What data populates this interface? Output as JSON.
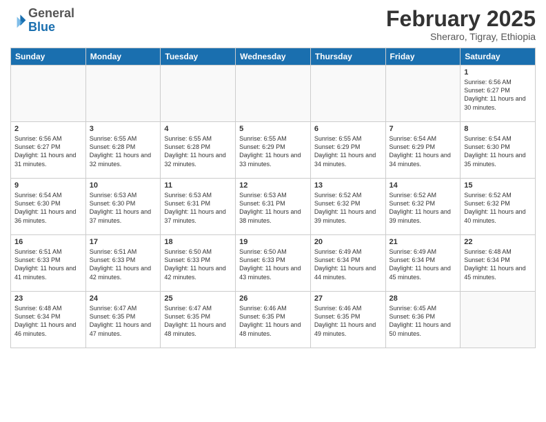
{
  "header": {
    "logo_general": "General",
    "logo_blue": "Blue",
    "month_year": "February 2025",
    "location": "Sheraro, Tigray, Ethiopia"
  },
  "days_of_week": [
    "Sunday",
    "Monday",
    "Tuesday",
    "Wednesday",
    "Thursday",
    "Friday",
    "Saturday"
  ],
  "weeks": [
    [
      {
        "day": "",
        "content": ""
      },
      {
        "day": "",
        "content": ""
      },
      {
        "day": "",
        "content": ""
      },
      {
        "day": "",
        "content": ""
      },
      {
        "day": "",
        "content": ""
      },
      {
        "day": "",
        "content": ""
      },
      {
        "day": "1",
        "content": "Sunrise: 6:56 AM\nSunset: 6:27 PM\nDaylight: 11 hours\nand 30 minutes."
      }
    ],
    [
      {
        "day": "2",
        "content": "Sunrise: 6:56 AM\nSunset: 6:27 PM\nDaylight: 11 hours\nand 31 minutes."
      },
      {
        "day": "3",
        "content": "Sunrise: 6:55 AM\nSunset: 6:28 PM\nDaylight: 11 hours\nand 32 minutes."
      },
      {
        "day": "4",
        "content": "Sunrise: 6:55 AM\nSunset: 6:28 PM\nDaylight: 11 hours\nand 32 minutes."
      },
      {
        "day": "5",
        "content": "Sunrise: 6:55 AM\nSunset: 6:29 PM\nDaylight: 11 hours\nand 33 minutes."
      },
      {
        "day": "6",
        "content": "Sunrise: 6:55 AM\nSunset: 6:29 PM\nDaylight: 11 hours\nand 34 minutes."
      },
      {
        "day": "7",
        "content": "Sunrise: 6:54 AM\nSunset: 6:29 PM\nDaylight: 11 hours\nand 34 minutes."
      },
      {
        "day": "8",
        "content": "Sunrise: 6:54 AM\nSunset: 6:30 PM\nDaylight: 11 hours\nand 35 minutes."
      }
    ],
    [
      {
        "day": "9",
        "content": "Sunrise: 6:54 AM\nSunset: 6:30 PM\nDaylight: 11 hours\nand 36 minutes."
      },
      {
        "day": "10",
        "content": "Sunrise: 6:53 AM\nSunset: 6:30 PM\nDaylight: 11 hours\nand 37 minutes."
      },
      {
        "day": "11",
        "content": "Sunrise: 6:53 AM\nSunset: 6:31 PM\nDaylight: 11 hours\nand 37 minutes."
      },
      {
        "day": "12",
        "content": "Sunrise: 6:53 AM\nSunset: 6:31 PM\nDaylight: 11 hours\nand 38 minutes."
      },
      {
        "day": "13",
        "content": "Sunrise: 6:52 AM\nSunset: 6:32 PM\nDaylight: 11 hours\nand 39 minutes."
      },
      {
        "day": "14",
        "content": "Sunrise: 6:52 AM\nSunset: 6:32 PM\nDaylight: 11 hours\nand 39 minutes."
      },
      {
        "day": "15",
        "content": "Sunrise: 6:52 AM\nSunset: 6:32 PM\nDaylight: 11 hours\nand 40 minutes."
      }
    ],
    [
      {
        "day": "16",
        "content": "Sunrise: 6:51 AM\nSunset: 6:33 PM\nDaylight: 11 hours\nand 41 minutes."
      },
      {
        "day": "17",
        "content": "Sunrise: 6:51 AM\nSunset: 6:33 PM\nDaylight: 11 hours\nand 42 minutes."
      },
      {
        "day": "18",
        "content": "Sunrise: 6:50 AM\nSunset: 6:33 PM\nDaylight: 11 hours\nand 42 minutes."
      },
      {
        "day": "19",
        "content": "Sunrise: 6:50 AM\nSunset: 6:33 PM\nDaylight: 11 hours\nand 43 minutes."
      },
      {
        "day": "20",
        "content": "Sunrise: 6:49 AM\nSunset: 6:34 PM\nDaylight: 11 hours\nand 44 minutes."
      },
      {
        "day": "21",
        "content": "Sunrise: 6:49 AM\nSunset: 6:34 PM\nDaylight: 11 hours\nand 45 minutes."
      },
      {
        "day": "22",
        "content": "Sunrise: 6:48 AM\nSunset: 6:34 PM\nDaylight: 11 hours\nand 45 minutes."
      }
    ],
    [
      {
        "day": "23",
        "content": "Sunrise: 6:48 AM\nSunset: 6:34 PM\nDaylight: 11 hours\nand 46 minutes."
      },
      {
        "day": "24",
        "content": "Sunrise: 6:47 AM\nSunset: 6:35 PM\nDaylight: 11 hours\nand 47 minutes."
      },
      {
        "day": "25",
        "content": "Sunrise: 6:47 AM\nSunset: 6:35 PM\nDaylight: 11 hours\nand 48 minutes."
      },
      {
        "day": "26",
        "content": "Sunrise: 6:46 AM\nSunset: 6:35 PM\nDaylight: 11 hours\nand 48 minutes."
      },
      {
        "day": "27",
        "content": "Sunrise: 6:46 AM\nSunset: 6:35 PM\nDaylight: 11 hours\nand 49 minutes."
      },
      {
        "day": "28",
        "content": "Sunrise: 6:45 AM\nSunset: 6:36 PM\nDaylight: 11 hours\nand 50 minutes."
      },
      {
        "day": "",
        "content": ""
      }
    ]
  ]
}
